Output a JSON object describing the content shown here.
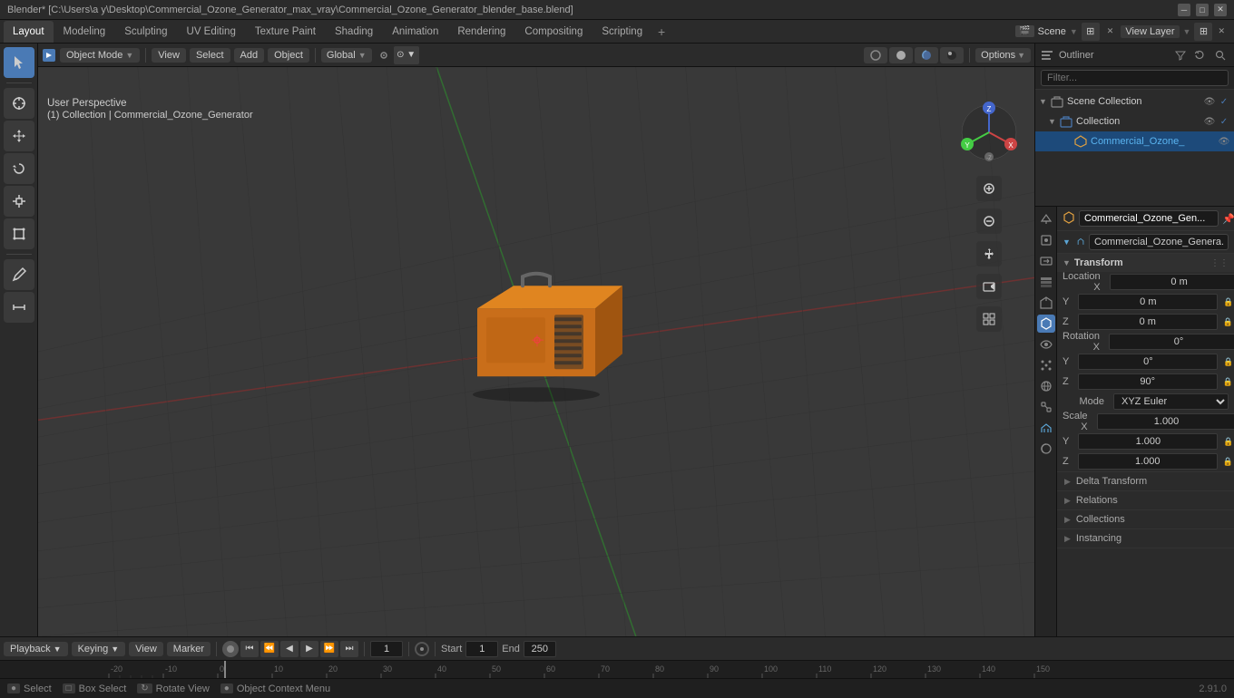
{
  "titlebar": {
    "title": "Blender* [C:\\Users\\a y\\Desktop\\Commercial_Ozone_Generator_max_vray\\Commercial_Ozone_Generator_blender_base.blend]",
    "minimize": "─",
    "maximize": "□",
    "close": "✕"
  },
  "workspace_tabs": {
    "tabs": [
      "Layout",
      "Modeling",
      "Sculpting",
      "UV Editing",
      "Texture Paint",
      "Shading",
      "Animation",
      "Rendering",
      "Compositing",
      "Scripting"
    ],
    "active": "Layout",
    "add_label": "+"
  },
  "scene": {
    "name": "Scene",
    "view_layer": "View Layer"
  },
  "viewport": {
    "mode": "Object Mode",
    "view_label": "View",
    "select_label": "Select",
    "add_label": "Add",
    "object_label": "Object",
    "transform": "Global",
    "perspective_label": "User Perspective",
    "collection_label": "(1) Collection | Commercial_Ozone_Generator",
    "options_label": "Options"
  },
  "outliner": {
    "search_placeholder": "Filter...",
    "scene_collection": "Scene Collection",
    "collection": "Collection",
    "object_name": "Commercial_Ozone_",
    "object_name_full": "Commercial_Ozone_Generator"
  },
  "properties": {
    "object_name": "Commercial_Ozone_Gen...",
    "mesh_name": "Commercial_Ozone_Genera...",
    "transform": {
      "title": "Transform",
      "location_x": "0 m",
      "location_y": "0 m",
      "location_z": "0 m",
      "rotation_x": "0°",
      "rotation_y": "0°",
      "rotation_z": "90°",
      "mode": "XYZ Euler",
      "scale_x": "1.000",
      "scale_y": "1.000",
      "scale_z": "1.000"
    },
    "delta_transform": "Delta Transform",
    "relations": "Relations",
    "collections": "Collections",
    "instancing": "Instancing"
  },
  "timeline": {
    "playback_label": "Playback",
    "keying_label": "Keying",
    "view_label": "View",
    "marker_label": "Marker",
    "frame_current": "1",
    "start_label": "Start",
    "start_frame": "1",
    "end_label": "End",
    "end_frame": "250"
  },
  "status_bar": {
    "select_key": "Select",
    "box_select_key": "Box Select",
    "rotate_view": "Rotate View",
    "object_context": "Object Context Menu",
    "version": "2.91.0"
  },
  "icons": {
    "cursor": "⊕",
    "move": "✥",
    "rotate": "↻",
    "scale": "⊞",
    "transform": "⊡",
    "measure": "📏",
    "annotate": "✏",
    "object_mode": "▼",
    "scene_icon": "🎬",
    "eye": "👁",
    "lock": "🔒",
    "camera": "📷",
    "zoom_in": "+",
    "zoom_out": "−",
    "hand": "✋",
    "render": "⬡",
    "grid": "⊞"
  }
}
